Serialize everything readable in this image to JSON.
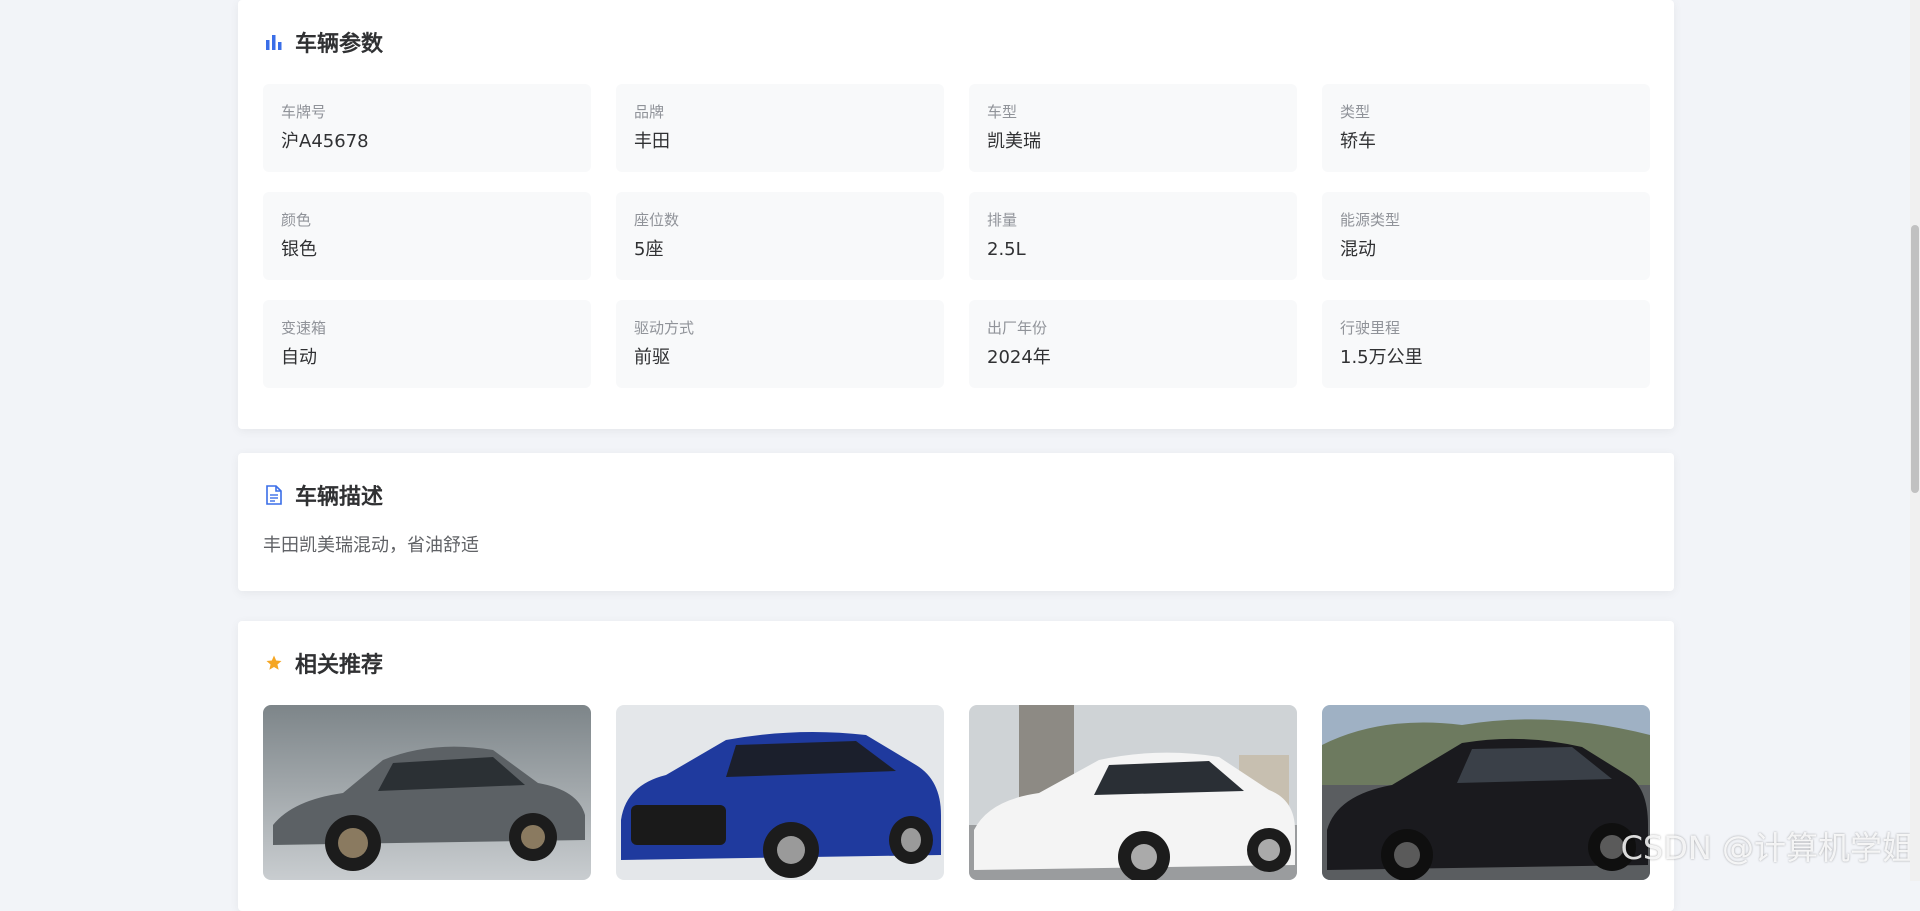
{
  "params": {
    "title": "车辆参数",
    "icon": "bar-chart-icon",
    "items": [
      {
        "label": "车牌号",
        "value": "沪A45678"
      },
      {
        "label": "品牌",
        "value": "丰田"
      },
      {
        "label": "车型",
        "value": "凯美瑞"
      },
      {
        "label": "类型",
        "value": "轿车"
      },
      {
        "label": "颜色",
        "value": "银色"
      },
      {
        "label": "座位数",
        "value": "5座"
      },
      {
        "label": "排量",
        "value": "2.5L"
      },
      {
        "label": "能源类型",
        "value": "混动"
      },
      {
        "label": "变速箱",
        "value": "自动"
      },
      {
        "label": "驱动方式",
        "value": "前驱"
      },
      {
        "label": "出厂年份",
        "value": "2024年"
      },
      {
        "label": "行驶里程",
        "value": "1.5万公里"
      }
    ]
  },
  "description": {
    "title": "车辆描述",
    "icon": "document-icon",
    "text": "丰田凯美瑞混动，省油舒适"
  },
  "recommendations": {
    "title": "相关推荐",
    "icon": "star-icon",
    "items": [
      {
        "image": "car-photo-gray-sedan",
        "color": "#5f6468"
      },
      {
        "image": "car-photo-blue-suv",
        "color": "#1f3a9e"
      },
      {
        "image": "car-photo-white-sedan",
        "color": "#f4f4f4"
      },
      {
        "image": "car-photo-black-sedan",
        "color": "#1a1a1e"
      }
    ]
  },
  "watermark": "CSDN @计算机学姐",
  "colors": {
    "accent": "#3a6ee8",
    "star": "#f5a623",
    "background": "#f2f4f8"
  }
}
